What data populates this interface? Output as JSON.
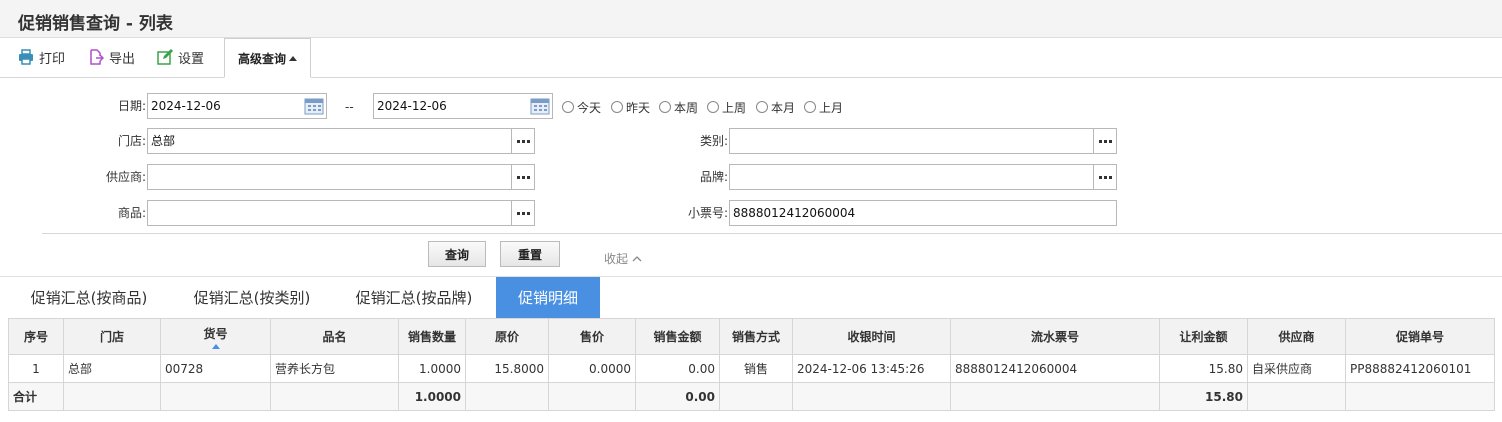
{
  "window": {
    "title": "促销销售查询 - 列表"
  },
  "toolbar": {
    "print_label": "打印",
    "export_label": "导出",
    "settings_label": "设置",
    "advanced_label": "高级查询"
  },
  "filters": {
    "date_label": "日期:",
    "date_from": "2024-12-06",
    "date_sep": "--",
    "date_to": "2024-12-06",
    "quick_dates": [
      "今天",
      "昨天",
      "本周",
      "上周",
      "本月",
      "上月"
    ],
    "store_label": "门店:",
    "store_value": "总部",
    "category_label": "类别:",
    "category_value": "",
    "supplier_label": "供应商:",
    "supplier_value": "",
    "brand_label": "品牌:",
    "brand_value": "",
    "product_label": "商品:",
    "product_value": "",
    "receipt_label": "小票号:",
    "receipt_value": "8888012412060004"
  },
  "actions": {
    "search_label": "查询",
    "reset_label": "重置",
    "collapse_label": "收起"
  },
  "tabs": [
    {
      "label": "促销汇总(按商品)",
      "active": false
    },
    {
      "label": "促销汇总(按类别)",
      "active": false
    },
    {
      "label": "促销汇总(按品牌)",
      "active": false
    },
    {
      "label": "促销明细",
      "active": true
    }
  ],
  "table": {
    "columns": [
      "序号",
      "门店",
      "货号",
      "品名",
      "销售数量",
      "原价",
      "售价",
      "销售金额",
      "销售方式",
      "收银时间",
      "流水票号",
      "让利金额",
      "供应商",
      "促销单号"
    ],
    "sorted_column": "货号",
    "rows": [
      [
        "1",
        "总部",
        "00728",
        "营养长方包",
        "1.0000",
        "15.8000",
        "0.0000",
        "0.00",
        "销售",
        "2024-12-06 13:45:26",
        "8888012412060004",
        "15.80",
        "自采供应商",
        "PP88882412060101"
      ]
    ],
    "total": {
      "label": "合计",
      "qty": "1.0000",
      "amount": "0.00",
      "discount": "15.80"
    }
  },
  "colors": {
    "accent": "#4a90e2"
  }
}
